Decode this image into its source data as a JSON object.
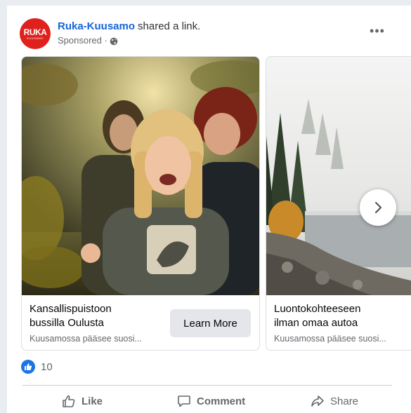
{
  "post": {
    "page_name": "Ruka-Kuusamo",
    "action_text": "shared a link.",
    "sponsored": "Sponsored ·",
    "avatar_logo": "RUKA",
    "avatar_sub": "KUUSAMO",
    "more": "•••"
  },
  "carousel": {
    "items": [
      {
        "title_line1": "Kansallispuistoon",
        "title_line2": "bussilla Oulusta",
        "subtitle": "Kuusamossa pääsee suosi...",
        "button": "Learn More"
      },
      {
        "title_line1": "Luontokohteeseen",
        "title_line2": "ilman omaa autoa",
        "subtitle": "Kuusamossa pääsee suosi..."
      }
    ]
  },
  "reactions": {
    "count": "10"
  },
  "actions": {
    "like": "Like",
    "comment": "Comment",
    "share": "Share"
  },
  "colors": {
    "brand_red": "#e0201c",
    "link_blue": "#1764d8",
    "like_blue": "#1b74e4"
  },
  "icons": [
    "globe-icon",
    "more-icon",
    "chevron-right-icon",
    "like-reaction-icon",
    "thumbs-up-icon",
    "comment-icon",
    "share-icon"
  ]
}
